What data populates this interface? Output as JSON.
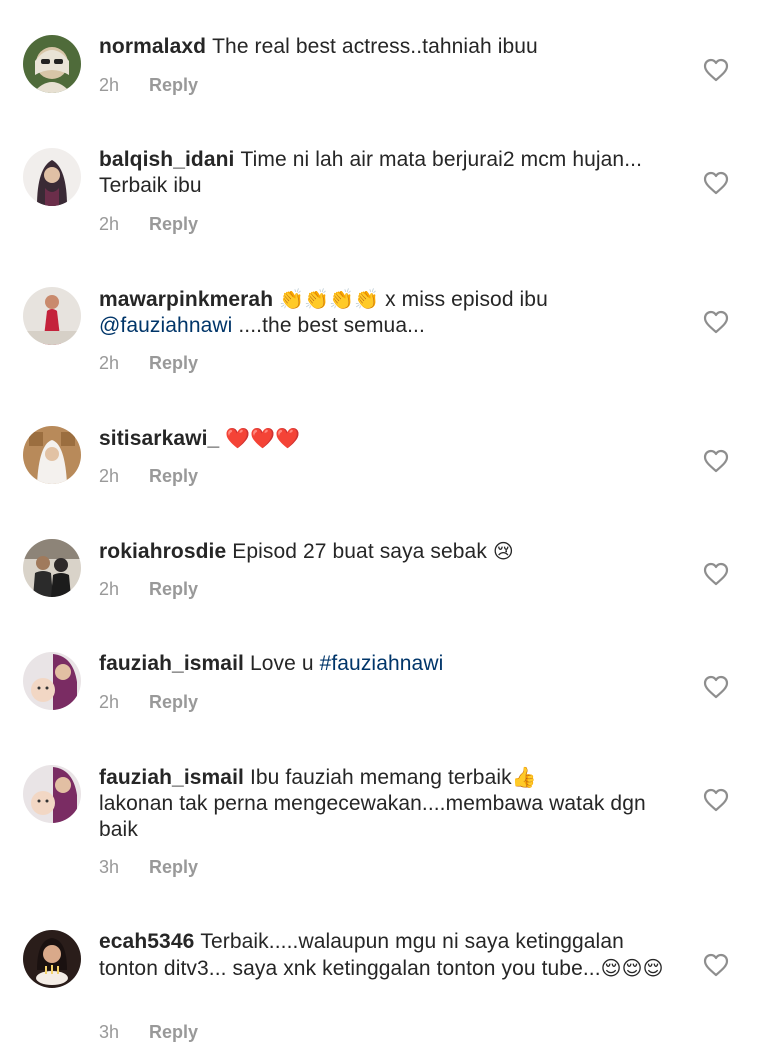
{
  "comments": [
    {
      "username": "normalaxd",
      "text": "The real best actress..tahniah ibuu",
      "time": "2h",
      "reply": "Reply",
      "avatar": "woman-sunglasses-avatar"
    },
    {
      "username": "balqish_idani",
      "text": "Time ni lah air mata berjurai2 mcm hujan... Terbaik ibu",
      "time": "2h",
      "reply": "Reply",
      "avatar": "woman-hijab-avatar"
    },
    {
      "username": "mawarpinkmerah",
      "emoji_prefix": "👏👏👏👏",
      "text_a": " x miss episod ibu",
      "mention": "@fauziahnawi",
      "text_b": " ....the best semua...",
      "time": "2h",
      "reply": "Reply",
      "avatar": "woman-red-dress-avatar"
    },
    {
      "username": "sitisarkawi_",
      "emoji": "❤️❤️❤️",
      "time": "2h",
      "reply": "Reply",
      "avatar": "woman-white-hijab-avatar"
    },
    {
      "username": "rokiahrosdie",
      "text": "Episod 27 buat saya sebak",
      "emoji": "😢",
      "time": "2h",
      "reply": "Reply",
      "avatar": "couple-avatar"
    },
    {
      "username": "fauziah_ismail",
      "text": "Love u",
      "hashtag": "#fauziahnawi",
      "time": "2h",
      "reply": "Reply",
      "avatar": "woman-with-baby-avatar"
    },
    {
      "username": "fauziah_ismail",
      "text_a": "Ibu fauziah memang terbaik",
      "emoji": "👍",
      "text_b": "lakonan tak perna mengecewakan....membawa watak dgn baik",
      "time": "3h",
      "reply": "Reply",
      "avatar": "woman-with-baby-avatar"
    },
    {
      "username": "ecah5346",
      "text": "Terbaik.....walaupun mgu ni saya ketinggalan tonton ditv3... saya xnk ketinggalan tonton you tube...",
      "emoji": "😌😌😌",
      "time": "3h",
      "reply": "Reply",
      "avatar": "woman-with-cake-avatar"
    }
  ],
  "icons": {
    "like": "heart-outline-icon"
  },
  "colors": {
    "text": "#262626",
    "meta": "#999999",
    "link": "#003569",
    "icon": "#8e8e8e"
  }
}
